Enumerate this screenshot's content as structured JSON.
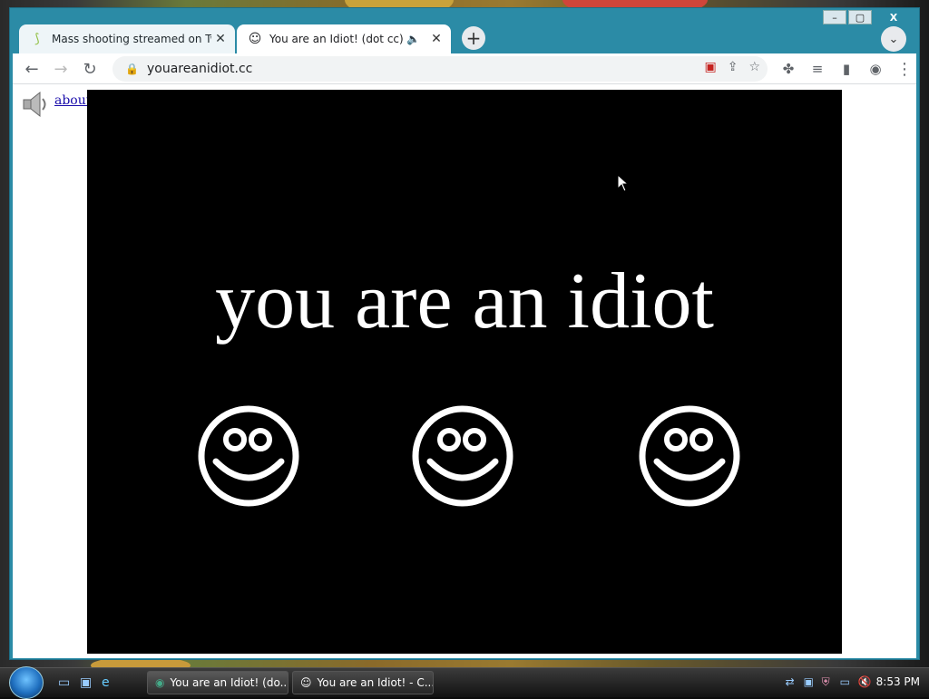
{
  "tabs": [
    {
      "title": "Mass shooting streamed on Twitc",
      "favicon": "leaf-icon"
    },
    {
      "title": "You are an Idiot! (dot cc)",
      "favicon": "smiley-icon",
      "audio": true
    }
  ],
  "toolbar": {
    "url": "youareanidiot.cc"
  },
  "page": {
    "link": "about Zach",
    "headline": "you are an idiot"
  },
  "taskbar": {
    "tasks": [
      {
        "label": "You are an Idiot! (do..."
      },
      {
        "label": "You are an Idiot! - C..."
      }
    ],
    "clock": "8:53 PM"
  },
  "colors": {
    "window_frame": "#2b8ba6",
    "stage_bg": "#000000",
    "headline": "#ffffff",
    "link": "#1a0dab"
  }
}
